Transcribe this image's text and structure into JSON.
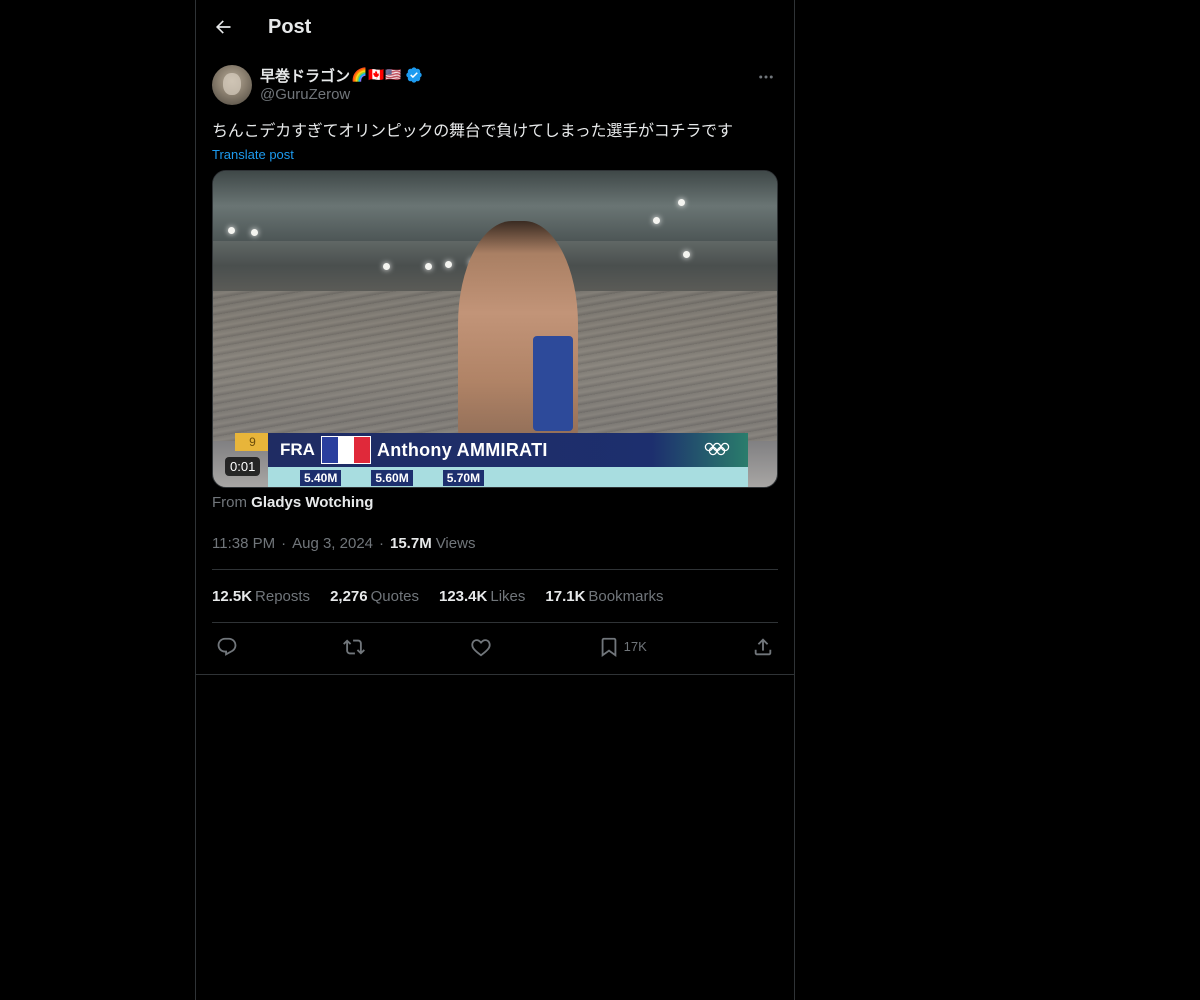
{
  "header": {
    "title": "Post"
  },
  "author": {
    "display_name": "早巻ドラゴン",
    "flags": [
      "🌈",
      "🇨🇦",
      "🇺🇸"
    ],
    "handle": "@GuruZerow",
    "verified": true
  },
  "post": {
    "text": "ちんこデカすぎてオリンピックの舞台で負けてしまった選手がコチラです",
    "translate_label": "Translate post",
    "media": {
      "duration": "0:01",
      "overlay": {
        "bib": "9",
        "country": "FRA",
        "athlete": "Anthony AMMIRATI",
        "heights": [
          "5.40M",
          "5.60M",
          "5.70M"
        ]
      }
    },
    "from_prefix": "From",
    "from_source": "Gladys Wotching",
    "time": "11:38 PM",
    "date": "Aug 3, 2024",
    "views_count": "15.7M",
    "views_label": "Views"
  },
  "stats": {
    "reposts": {
      "count": "12.5K",
      "label": "Reposts"
    },
    "quotes": {
      "count": "2,276",
      "label": "Quotes"
    },
    "likes": {
      "count": "123.4K",
      "label": "Likes"
    },
    "bookmarks": {
      "count": "17.1K",
      "label": "Bookmarks"
    }
  },
  "actions": {
    "reply": {
      "icon": "reply-icon"
    },
    "repost": {
      "icon": "repost-icon"
    },
    "like": {
      "icon": "heart-icon"
    },
    "bookmark": {
      "icon": "bookmark-icon",
      "count": "17K"
    },
    "share": {
      "icon": "share-icon"
    }
  },
  "colors": {
    "background": "#000000",
    "border": "#2f3336",
    "text_primary": "#e7e9ea",
    "text_secondary": "#71767b",
    "accent": "#1d9bf0"
  }
}
